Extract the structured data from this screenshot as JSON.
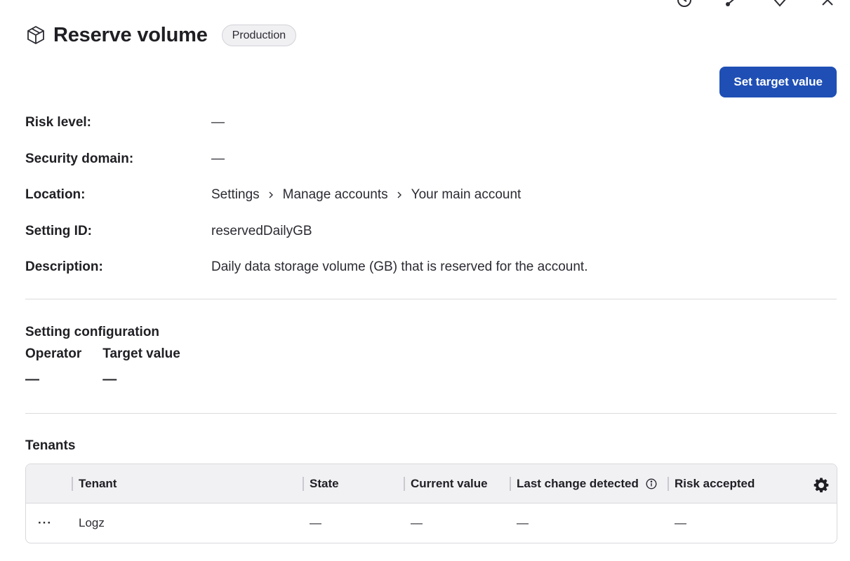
{
  "header": {
    "title": "Reserve volume",
    "badge": "Production",
    "icons": [
      "history-icon",
      "share-icon",
      "favorite-icon",
      "close-icon"
    ]
  },
  "actions": {
    "set_target_label": "Set target value"
  },
  "properties": {
    "risk_level": {
      "label": "Risk level:",
      "value": "—"
    },
    "security_domain": {
      "label": "Security domain:",
      "value": "—"
    },
    "location": {
      "label": "Location:",
      "crumbs": [
        "Settings",
        "Manage accounts",
        "Your main account"
      ]
    },
    "setting_id": {
      "label": "Setting ID:",
      "value": "reservedDailyGB"
    },
    "description": {
      "label": "Description:",
      "value": "Daily data storage volume (GB) that is reserved for the account."
    }
  },
  "configuration": {
    "title": "Setting configuration",
    "operator_label": "Operator",
    "operator_value": "—",
    "target_label": "Target value",
    "target_value": "—"
  },
  "tenants": {
    "title": "Tenants",
    "columns": [
      "Tenant",
      "State",
      "Current value",
      "Last change detected",
      "Risk accepted"
    ],
    "rows": [
      {
        "menu": "···",
        "tenant": "Logz",
        "state": "—",
        "current_value": "—",
        "last_change": "—",
        "risk_accepted": "—"
      }
    ]
  },
  "colors": {
    "primary": "#1f4fb5",
    "header_bg": "#f1f1f4",
    "border": "#d9d9de"
  }
}
